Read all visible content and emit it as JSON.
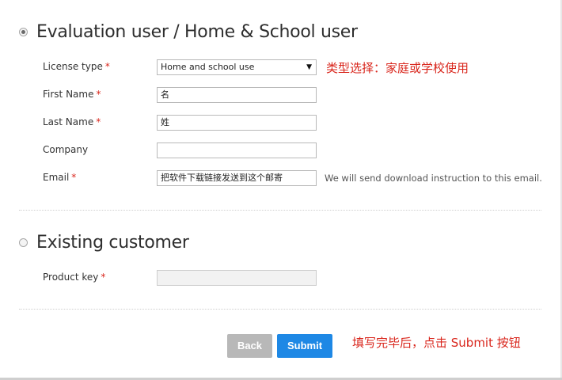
{
  "evaluation": {
    "title": "Evaluation user / Home & School user",
    "selected": true,
    "license_type": {
      "label": "License type",
      "required_mark": "*",
      "value": "Home and school use",
      "arrow": "▼"
    },
    "first_name": {
      "label": "First Name",
      "required_mark": "*",
      "value": "名"
    },
    "last_name": {
      "label": "Last Name",
      "required_mark": "*",
      "value": "姓"
    },
    "company": {
      "label": "Company",
      "value": ""
    },
    "email": {
      "label": "Email",
      "required_mark": "*",
      "value": "把软件下载链接发送到这个邮寄",
      "note": "We will send download instruction to this email."
    }
  },
  "existing": {
    "title": "Existing customer",
    "selected": false,
    "product_key": {
      "label": "Product key",
      "required_mark": "*",
      "value": ""
    }
  },
  "buttons": {
    "back": "Back",
    "submit": "Submit"
  },
  "annotations": {
    "license": "类型选择：家庭或学校使用",
    "submit": "填写完毕后，点击 Submit 按钮"
  }
}
